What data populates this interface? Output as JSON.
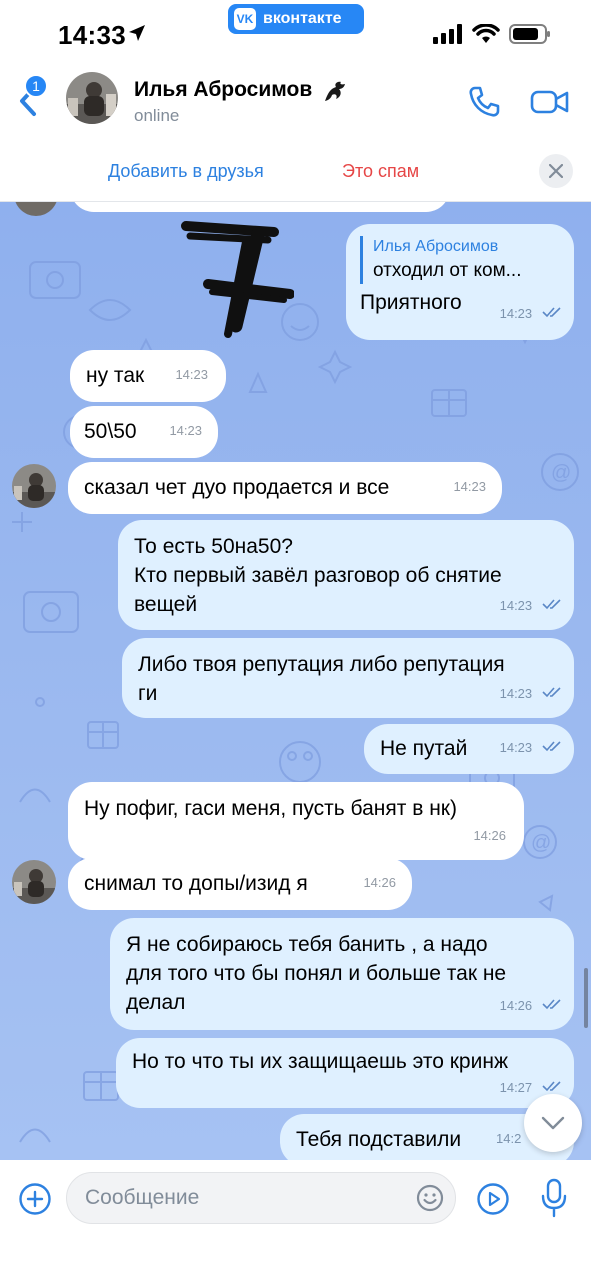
{
  "status_bar": {
    "time": "14:33",
    "app_pill": "вконтакте",
    "vk_logo": "VK"
  },
  "header": {
    "back_badge": "1",
    "contact_name": "Илья Абросимов",
    "status": "online",
    "icons": [
      "back-chevron-icon",
      "dragon-icon",
      "phone-icon",
      "video-camera-icon"
    ]
  },
  "friend_bar": {
    "add_friend": "Добавить в друзья",
    "spam": "Это спам"
  },
  "overlay": {
    "scribble": "7"
  },
  "messages": [
    {
      "dir": "out",
      "reply_name": "Илья Абросимов",
      "reply_text": "отходил от ком...",
      "text": "Приятного",
      "time": "14:23"
    },
    {
      "dir": "in",
      "text": "ну так",
      "time": "14:23"
    },
    {
      "dir": "in",
      "text": "50\\50",
      "time": "14:23"
    },
    {
      "dir": "in",
      "text": "сказал чет дуо продается и все",
      "time": "14:23"
    },
    {
      "dir": "out",
      "line1": "То есть 50на50?",
      "line2": "Кто первый завёл разговор об снятие",
      "line3": "вещей",
      "time": "14:23"
    },
    {
      "dir": "out",
      "line1": "Либо твоя репутация либо репутация",
      "line2": "ги",
      "time": "14:23"
    },
    {
      "dir": "out",
      "text": "Не путай",
      "time": "14:23"
    },
    {
      "dir": "in",
      "text": "Ну пофиг, гаси меня, пусть банят в нк)",
      "time": "14:26"
    },
    {
      "dir": "in",
      "text": "снимал то допы/изид я",
      "time": "14:26"
    },
    {
      "dir": "out",
      "line1": "Я не собираюсь тебя банить , а надо",
      "line2": "для того что бы понял и больше так не",
      "line3": "делал",
      "time": "14:26"
    },
    {
      "dir": "out",
      "text": "Но то что ты их защищаешь это кринж",
      "time": "14:27"
    },
    {
      "dir": "out",
      "text": "Тебя подставили",
      "time": "14:2"
    }
  ],
  "composer": {
    "placeholder": "Сообщение"
  },
  "colors": {
    "accent": "#2787f5",
    "link": "#2d81e0",
    "spam": "#e64646",
    "bubble_out": "#dff0ff",
    "bubble_in": "#ffffff",
    "chat_bg": "#9ab8ef"
  }
}
